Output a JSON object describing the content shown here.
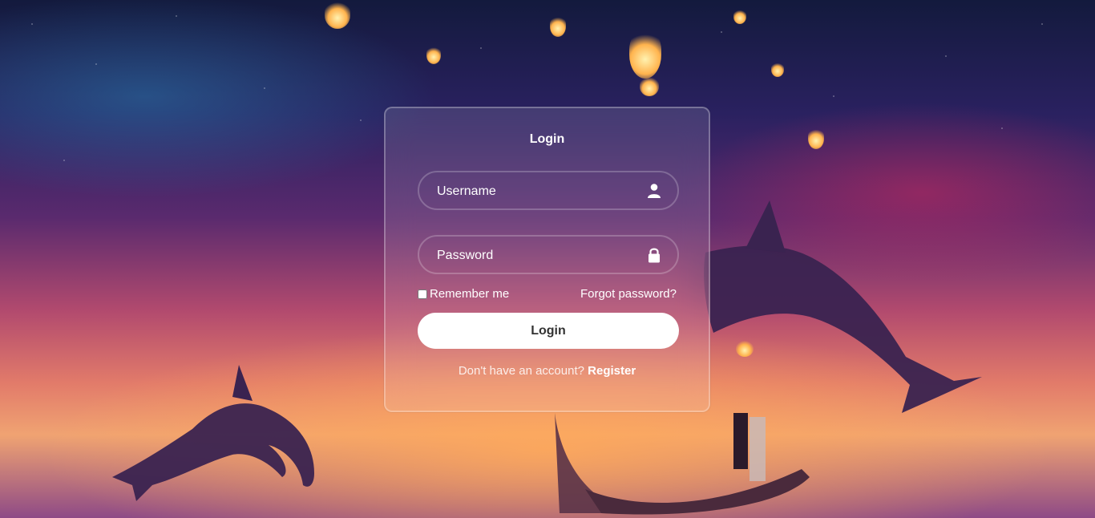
{
  "login_card": {
    "title": "Login",
    "username_placeholder": "Username",
    "password_placeholder": "Password",
    "remember_label": "Remember me",
    "forgot_link": "Forgot password?",
    "submit_label": "Login",
    "register_prompt": "Don't have an account?",
    "register_link": "Register"
  },
  "icons": {
    "username": "user-icon",
    "password": "lock-icon"
  },
  "colors": {
    "card_border": "#ffffff",
    "button_bg": "#ffffff",
    "button_text": "#333333",
    "text": "#ffffff"
  }
}
